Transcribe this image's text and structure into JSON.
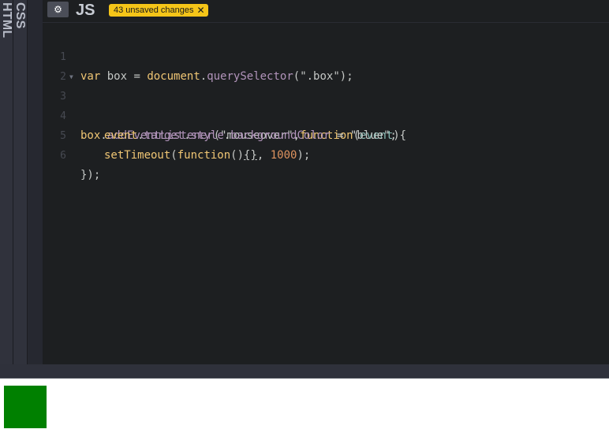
{
  "tabs": {
    "html_label": "HTML",
    "css_label": "CSS"
  },
  "editor": {
    "title": "JS",
    "gear_icon": "gear-icon",
    "unsaved_badge": "43 unsaved changes",
    "unsaved_close": "✕",
    "lines": [
      {
        "num": "1"
      },
      {
        "num": "2"
      },
      {
        "num": "3"
      },
      {
        "num": "4"
      },
      {
        "num": "5"
      },
      {
        "num": "6"
      }
    ],
    "code": {
      "l1_var": "var",
      "l1_box": " box ",
      "l1_eq": "= ",
      "l1_document": "document",
      "l1_dot": ".",
      "l1_qs": "querySelector",
      "l1_rest": "(\".box\");",
      "l3_box": "box",
      "l3_dot": ".",
      "l3_ael": "addEventListener",
      "l3_paren": "(\"mouseover\",",
      "l3_function": "function",
      "l3_open": "(",
      "l3_event": "event",
      "l3_close": "){",
      "l4_event": "event",
      "l4_dot1": ".",
      "l4_target": "target",
      "l4_dot2": ".",
      "l4_style": "style",
      "l4_dot3": ".",
      "l4_bg": "backgroundColor",
      "l4_rest": " = \"blue\";",
      "l5_settimeout": "setTimeout",
      "l5_open": "(",
      "l5_function": "function",
      "l5_parens": "()",
      "l5_braces": "{}",
      "l5_comma": ", ",
      "l5_num": "1000",
      "l5_end": ");",
      "l6_end": "});"
    }
  },
  "result": {
    "box_color": "#008000"
  }
}
